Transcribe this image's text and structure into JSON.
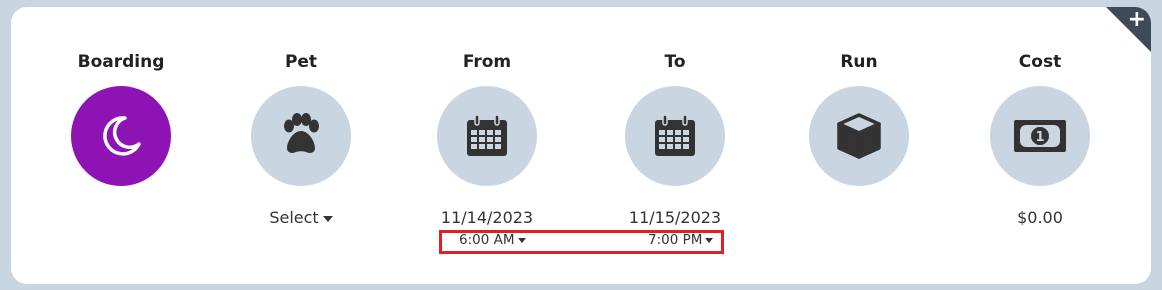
{
  "columns": {
    "boarding": {
      "label": "Boarding",
      "icon": "moon-icon"
    },
    "pet": {
      "label": "Pet",
      "icon": "paw-icon",
      "value": "Select"
    },
    "from": {
      "label": "From",
      "icon": "calendar-icon",
      "date": "11/14/2023",
      "time": "6:00 AM"
    },
    "to": {
      "label": "To",
      "icon": "calendar-icon",
      "date": "11/15/2023",
      "time": "7:00 PM"
    },
    "run": {
      "label": "Run",
      "icon": "box-icon"
    },
    "cost": {
      "label": "Cost",
      "icon": "money-icon",
      "value": "$0.00"
    }
  },
  "corner_button": {
    "icon": "plus-icon",
    "symbol": "+"
  },
  "colors": {
    "accent": "#8e13b5",
    "circle": "#c9d5e1",
    "highlight": "#e31e24",
    "icon": "#333333"
  }
}
